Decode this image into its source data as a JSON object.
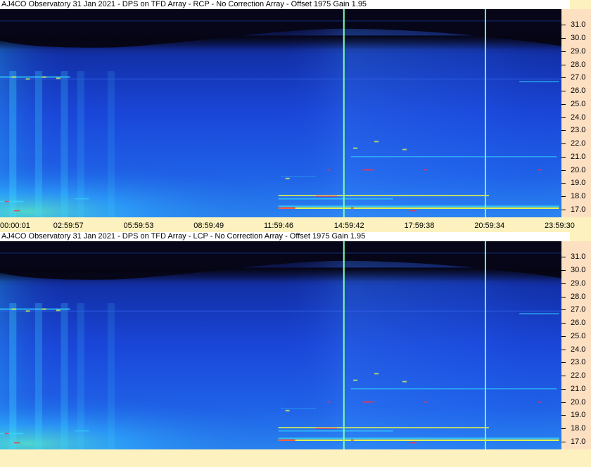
{
  "window": {
    "title_rcp": "AJ4CO Observatory 31 Jan 2021 - DPS on TFD Array  - RCP  -  No Correction Array  -  Offset 1975  Gain 1.95",
    "title_lcp": "AJ4CO Observatory 31 Jan 2021 - DPS on TFD Array  - LCP  -  No Correction Array  -  Offset 1975  Gain 1.95"
  },
  "colors": {
    "background": "#fdf2bf",
    "axis_panel": "#fde0c2",
    "cursor_line": "#7dffb0",
    "sky_dark": "#0a0a2a",
    "sky_blue": "#1a3fd6",
    "emission_cyan": "#34e0ff",
    "emission_yellow": "#f4ff40",
    "emission_red": "#ff3040"
  },
  "chart_data": [
    {
      "type": "heatmap",
      "name": "RCP",
      "x_tick_labels": [
        "00:00:01",
        "02:59:57",
        "05:59:53",
        "08:59:49",
        "11:59:46",
        "14:59:42",
        "17:59:38",
        "20:59:34",
        "23:59:30"
      ],
      "y_tick_labels": [
        "31.0",
        "30.0",
        "29.0",
        "28.0",
        "27.0",
        "26.0",
        "25.0",
        "24.0",
        "23.0",
        "22.0",
        "21.0",
        "20.0",
        "19.0",
        "18.0",
        "17.0"
      ],
      "y_values": [
        31.0,
        30.0,
        29.0,
        28.0,
        27.0,
        26.0,
        25.0,
        24.0,
        23.0,
        22.0,
        21.0,
        20.0,
        19.0,
        18.0,
        17.0
      ],
      "x_values_hours": [
        0.0003,
        3.0,
        6.0,
        9.0,
        12.0,
        15.0,
        18.0,
        21.0,
        24.0
      ],
      "ylim": [
        16.4,
        32.2
      ],
      "xlim_hours": [
        0,
        24
      ],
      "cursor_lines_hours": [
        14.7,
        20.75
      ]
    },
    {
      "type": "heatmap",
      "name": "LCP",
      "y_tick_labels": [
        "31.0",
        "30.0",
        "29.0",
        "28.0",
        "27.0",
        "26.0",
        "25.0",
        "24.0",
        "23.0",
        "22.0",
        "21.0",
        "20.0",
        "19.0",
        "18.0",
        "17.0"
      ],
      "y_values": [
        31.0,
        30.0,
        29.0,
        28.0,
        27.0,
        26.0,
        25.0,
        24.0,
        23.0,
        22.0,
        21.0,
        20.0,
        19.0,
        18.0,
        17.0
      ],
      "ylim": [
        16.4,
        32.2
      ],
      "xlim_hours": [
        0,
        24
      ],
      "cursor_lines_hours": [
        14.7,
        20.75
      ]
    }
  ]
}
